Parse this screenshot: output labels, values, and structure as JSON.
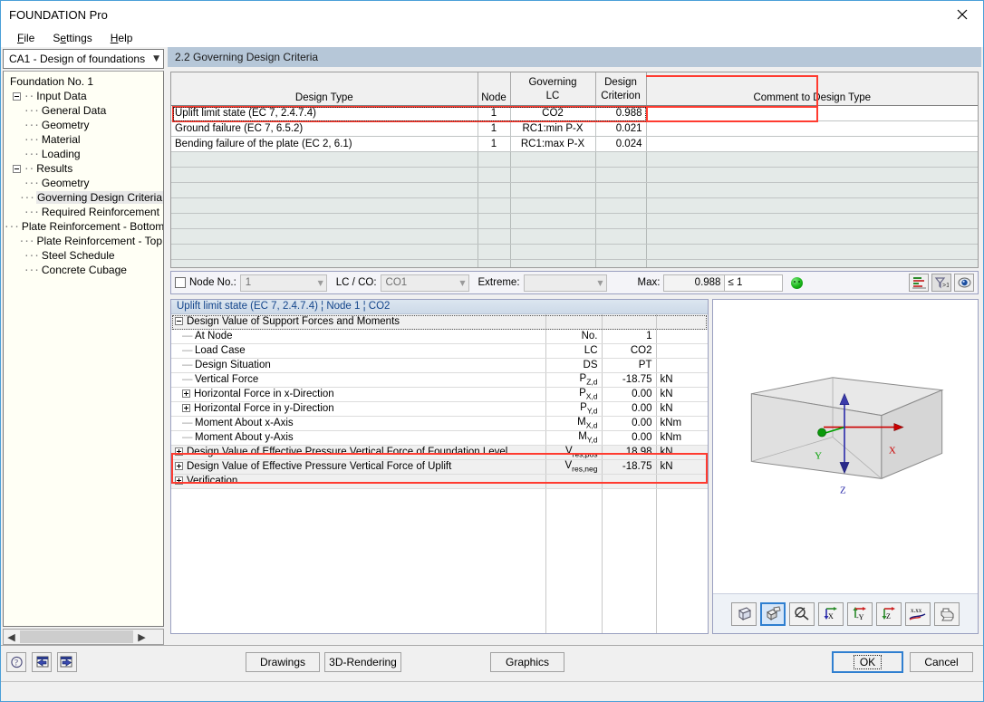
{
  "window": {
    "title": "FOUNDATION Pro",
    "close_icon": "close-icon"
  },
  "menu": {
    "items": [
      "File",
      "Settings",
      "Help"
    ]
  },
  "sidebar": {
    "combo_value": "CA1 - Design of foundations",
    "tree": [
      {
        "label": "Foundation No. 1",
        "depth": 0,
        "expander": false,
        "selected": false
      },
      {
        "label": "Input Data",
        "depth": 1,
        "expander": true,
        "selected": false
      },
      {
        "label": "General Data",
        "depth": 2,
        "expander": false,
        "selected": false
      },
      {
        "label": "Geometry",
        "depth": 2,
        "expander": false,
        "selected": false
      },
      {
        "label": "Material",
        "depth": 2,
        "expander": false,
        "selected": false
      },
      {
        "label": "Loading",
        "depth": 2,
        "expander": false,
        "selected": false
      },
      {
        "label": "Results",
        "depth": 1,
        "expander": true,
        "selected": false
      },
      {
        "label": "Geometry",
        "depth": 2,
        "expander": false,
        "selected": false
      },
      {
        "label": "Governing Design Criteria",
        "depth": 2,
        "expander": false,
        "selected": true
      },
      {
        "label": "Required Reinforcement",
        "depth": 2,
        "expander": false,
        "selected": false
      },
      {
        "label": "Plate Reinforcement - Bottom",
        "depth": 2,
        "expander": false,
        "selected": false
      },
      {
        "label": "Plate Reinforcement - Top",
        "depth": 2,
        "expander": false,
        "selected": false
      },
      {
        "label": "Steel Schedule",
        "depth": 2,
        "expander": false,
        "selected": false
      },
      {
        "label": "Concrete Cubage",
        "depth": 2,
        "expander": false,
        "selected": false
      }
    ]
  },
  "pane": {
    "header": "2.2 Governing Design Criteria"
  },
  "grid": {
    "columns": [
      "Design Type",
      "Node",
      "Governing LC",
      "Design Criterion",
      "Comment to Design Type"
    ],
    "column_headers_multiline": [
      {
        "l1": "",
        "l2": "Design Type"
      },
      {
        "l1": "",
        "l2": "Node"
      },
      {
        "l1": "Governing",
        "l2": "LC"
      },
      {
        "l1": "Design",
        "l2": "Criterion"
      },
      {
        "l1": "",
        "l2": "Comment to Design Type"
      }
    ],
    "rows": [
      {
        "design_type": "Uplift limit state (EC 7, 2.4.7.4)",
        "node": "1",
        "lc": "CO2",
        "criterion": "0.988",
        "comment": "",
        "highlight": true
      },
      {
        "design_type": "Ground failure (EC 7, 6.5.2)",
        "node": "1",
        "lc": "RC1:min P-X",
        "criterion": "0.021",
        "comment": "",
        "highlight": false
      },
      {
        "design_type": "Bending failure of the plate (EC 2, 6.1)",
        "node": "1",
        "lc": "RC1:max P-X",
        "criterion": "0.024",
        "comment": "",
        "highlight": false
      }
    ]
  },
  "controls": {
    "node_checkbox_label": "Node No.:",
    "node_value": "1",
    "lc_co_label": "LC / CO:",
    "lc_co_value": "CO1",
    "extreme_label": "Extreme:",
    "extreme_value": "",
    "max_label": "Max:",
    "max_value": "0.988",
    "max_limit": "≤ 1",
    "status_icon": "smiley-green-icon",
    "icon_buttons": [
      "color-bars-icon",
      "filter-greater-than-1-icon",
      "eye-icon"
    ]
  },
  "detail": {
    "header": "Uplift limit state (EC 7, 2.4.7.4) ¦ Node 1 ¦ CO2",
    "rows": [
      {
        "kind": "group",
        "expander": "minus",
        "label": "Design Value of Support Forces and Moments",
        "symbol": "",
        "symbol_sub": "",
        "value": "",
        "unit": "",
        "highlight": false
      },
      {
        "kind": "leaf",
        "expander": "none",
        "label": "At Node",
        "symbol": "No.",
        "symbol_sub": "",
        "value": "1",
        "unit": "",
        "highlight": false
      },
      {
        "kind": "leaf",
        "expander": "none",
        "label": "Load Case",
        "symbol": "LC",
        "symbol_sub": "",
        "value": "CO2",
        "unit": "",
        "highlight": false
      },
      {
        "kind": "leaf",
        "expander": "none",
        "label": "Design Situation",
        "symbol": "DS",
        "symbol_sub": "",
        "value": "PT",
        "unit": "",
        "highlight": false
      },
      {
        "kind": "leaf",
        "expander": "none",
        "label": "Vertical Force",
        "symbol": "P",
        "symbol_sub": "Z,d",
        "value": "-18.75",
        "unit": "kN",
        "highlight": false
      },
      {
        "kind": "leaf",
        "expander": "plus",
        "label": "Horizontal Force in x-Direction",
        "symbol": "P",
        "symbol_sub": "X,d",
        "value": "0.00",
        "unit": "kN",
        "highlight": false
      },
      {
        "kind": "leaf",
        "expander": "plus",
        "label": "Horizontal Force in y-Direction",
        "symbol": "P",
        "symbol_sub": "Y,d",
        "value": "0.00",
        "unit": "kN",
        "highlight": false
      },
      {
        "kind": "leaf",
        "expander": "none",
        "label": "Moment About x-Axis",
        "symbol": "M",
        "symbol_sub": "X,d",
        "value": "0.00",
        "unit": "kNm",
        "highlight": false
      },
      {
        "kind": "leaf",
        "expander": "none",
        "label": "Moment About y-Axis",
        "symbol": "M",
        "symbol_sub": "Y,d",
        "value": "0.00",
        "unit": "kNm",
        "highlight": false
      },
      {
        "kind": "group",
        "expander": "plus",
        "label": "Design Value of Effective Pressure Vertical Force of Foundation Level",
        "symbol": "V",
        "symbol_sub": "res,pos",
        "value": "18.98",
        "unit": "kN",
        "highlight": true
      },
      {
        "kind": "group",
        "expander": "plus",
        "label": "Design Value of Effective Pressure Vertical Force of Uplift",
        "symbol": "V",
        "symbol_sub": "res,neg",
        "value": "-18.75",
        "unit": "kN",
        "highlight": true
      },
      {
        "kind": "group",
        "expander": "plus",
        "label": "Verification",
        "symbol": "",
        "symbol_sub": "",
        "value": "",
        "unit": "",
        "highlight": false
      }
    ]
  },
  "graphics": {
    "axis_labels": {
      "x": "X",
      "y": "Y",
      "z": "Z"
    },
    "axis_colors": {
      "x": "#cc0000",
      "y": "#00a000",
      "z": "#2a2aaa"
    },
    "toolbar_buttons": [
      "wireframe-cube-icon",
      "solid-cube-icon",
      "zoom-crosshair-icon",
      "view-x-icon",
      "view-negative-y-icon",
      "view-z-icon",
      "values-x-xx-icon",
      "print-icon"
    ],
    "selected_toolbar_button": "solid-cube-icon"
  },
  "bottom": {
    "left_icons": [
      "help-question-icon",
      "previous-arrow-icon",
      "next-arrow-icon"
    ],
    "buttons": [
      "Drawings",
      "3D-Rendering",
      "Graphics"
    ],
    "ok_label": "OK",
    "cancel_label": "Cancel"
  }
}
